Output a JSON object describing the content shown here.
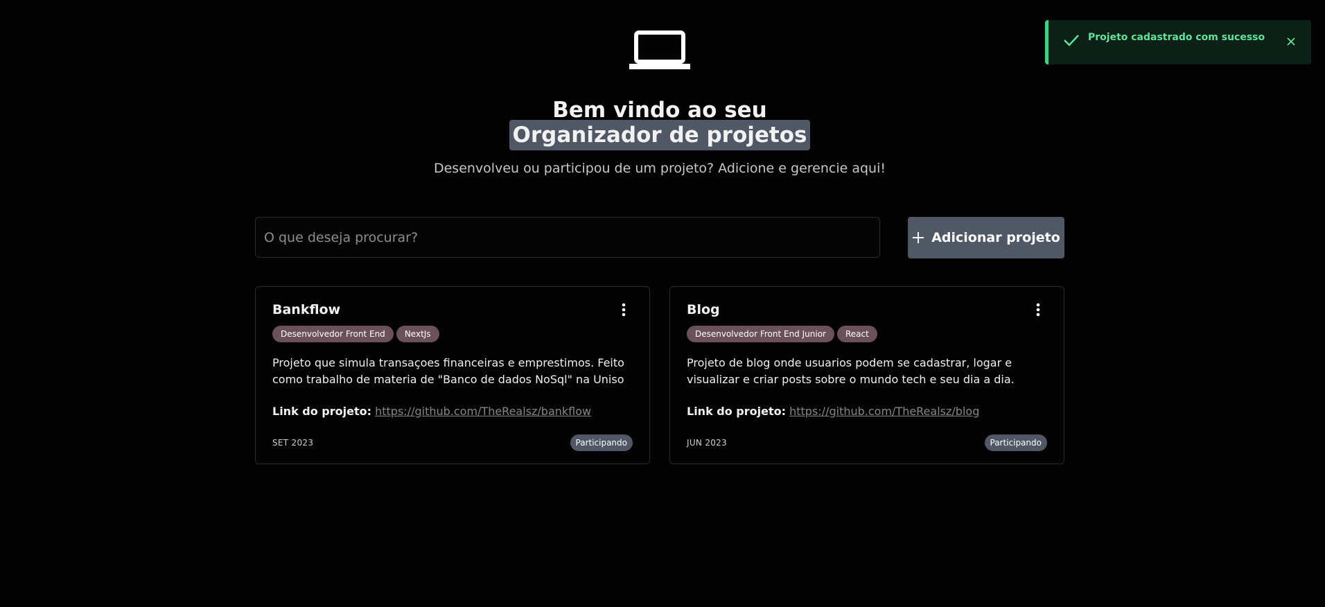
{
  "header": {
    "icon": "laptop-icon",
    "title_line1": "Bem vindo ao seu",
    "title_line2": "Organizador de projetos",
    "subtitle": "Desenvolveu ou participou de um projeto? Adicione e gerencie aqui!"
  },
  "search": {
    "placeholder": "O que deseja procurar?",
    "value": ""
  },
  "add_button": {
    "icon": "plus-icon",
    "label": "Adicionar projeto"
  },
  "projects": [
    {
      "title": "Bankflow",
      "menu_icon": "kebab-menu-icon",
      "tags": [
        "Desenvolvedor Front End",
        "NextJs"
      ],
      "description": "Projeto que simula transaçoes financeiras e emprestimos. Feito como trabalho de materia de \"Banco de dados NoSql\" na Uniso",
      "link_label": "Link do projeto:",
      "link": "https://github.com/TheRealsz/bankflow",
      "date": "SET 2023",
      "status": "Participando"
    },
    {
      "title": "Blog",
      "menu_icon": "kebab-menu-icon",
      "tags": [
        "Desenvolvedor Front End Junior",
        "React"
      ],
      "description": "Projeto de blog onde usuarios podem se cadastrar, logar e visualizar e criar posts sobre o mundo tech e seu dia a dia.",
      "link_label": "Link do projeto:",
      "link": "https://github.com/TheRealsz/blog",
      "date": "JUN 2023",
      "status": "Participando"
    }
  ],
  "toast": {
    "icon": "check-icon",
    "message": "Projeto cadastrado com sucesso",
    "close_icon": "close-icon"
  },
  "colors": {
    "background": "#020202",
    "accent": "#4f5864",
    "tag": "#6b515b",
    "success": "#3fd17f"
  }
}
